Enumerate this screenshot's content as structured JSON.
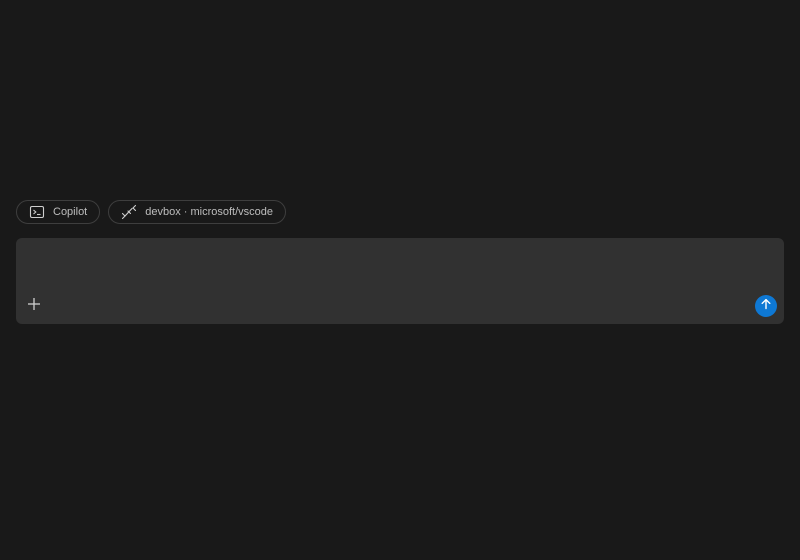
{
  "chips": {
    "agent": {
      "label": "Copilot",
      "icon": "terminal-icon"
    },
    "workspace": {
      "label": "devbox · microsoft/vscode",
      "icon": "remote-connection-icon"
    }
  },
  "composer": {
    "input_value": "",
    "input_placeholder": "",
    "add_icon": "plus-icon",
    "send_icon": "arrow-up-icon"
  },
  "colors": {
    "background": "#191919",
    "composer_background": "#313131",
    "chip_border": "#3e3e3e",
    "accent": "#0e78d4"
  }
}
